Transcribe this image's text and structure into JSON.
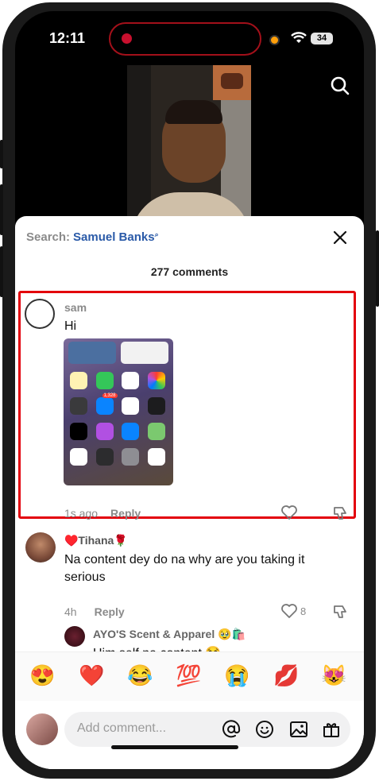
{
  "status_bar": {
    "time": "12:11",
    "battery": "34"
  },
  "search": {
    "label": "Search:",
    "term": "Samuel Banks",
    "term_icon": "search-icon"
  },
  "comments_count": "277 comments",
  "highlighted_comment": {
    "user": "sam",
    "text": "Hi",
    "time": "1s ago",
    "reply_label": "Reply",
    "screenshot_badge": "1,328"
  },
  "comments": [
    {
      "user": "♥️Tihana🌹",
      "text": "Na content dey do na why are you taking it serious",
      "time": "4h",
      "reply_label": "Reply",
      "likes": "8"
    },
    {
      "user": "AYO'S Scent & Apparel 🥹🛍️",
      "text": "Him self na content 😂"
    }
  ],
  "emoji_bar": [
    "😍",
    "❤️",
    "😂",
    "💯",
    "😭",
    "💋",
    "😻"
  ],
  "input": {
    "placeholder": "Add comment..."
  },
  "colors": {
    "accent": "#2a5aa8",
    "highlight": "#e3000b",
    "muted": "#8a8a8a"
  }
}
